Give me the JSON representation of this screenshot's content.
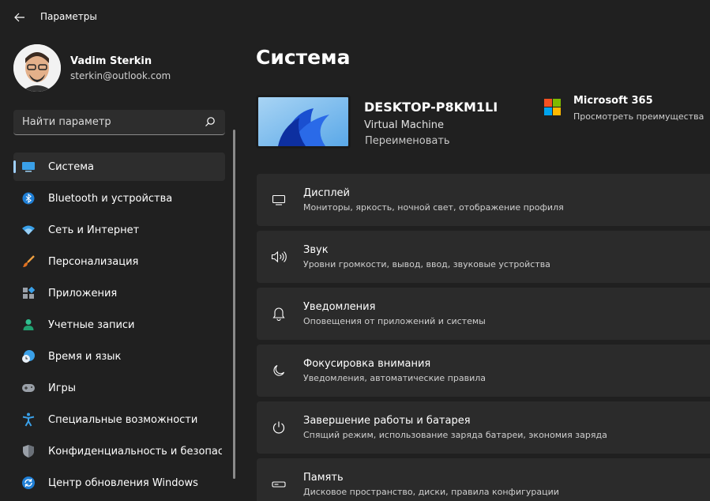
{
  "window": {
    "title": "Параметры"
  },
  "profile": {
    "name": "Vadim Sterkin",
    "email": "sterkin@outlook.com"
  },
  "search": {
    "placeholder": "Найти параметр"
  },
  "nav": {
    "items": [
      {
        "label": "Система",
        "icon": "monitor-icon",
        "active": true
      },
      {
        "label": "Bluetooth и устройства",
        "icon": "bluetooth-icon"
      },
      {
        "label": "Сеть и Интернет",
        "icon": "wifi-icon"
      },
      {
        "label": "Персонализация",
        "icon": "brush-icon"
      },
      {
        "label": "Приложения",
        "icon": "apps-icon"
      },
      {
        "label": "Учетные записи",
        "icon": "person-icon"
      },
      {
        "label": "Время и язык",
        "icon": "globe-clock-icon"
      },
      {
        "label": "Игры",
        "icon": "gamepad-icon"
      },
      {
        "label": "Специальные возможности",
        "icon": "accessibility-icon"
      },
      {
        "label": "Конфиденциальность и безопасность",
        "icon": "shield-icon"
      },
      {
        "label": "Центр обновления Windows",
        "icon": "update-icon"
      }
    ]
  },
  "main": {
    "title": "Система",
    "device": {
      "name": "DESKTOP-P8KM1LI",
      "type": "Virtual Machine",
      "rename": "Переименовать"
    },
    "promo": {
      "title": "Microsoft 365",
      "subtitle": "Просмотреть преимущества"
    },
    "cards": [
      {
        "title": "Дисплей",
        "subtitle": "Мониторы, яркость, ночной свет, отображение профиля",
        "icon": "display-icon"
      },
      {
        "title": "Звук",
        "subtitle": "Уровни громкости, вывод, ввод, звуковые устройства",
        "icon": "speaker-icon"
      },
      {
        "title": "Уведомления",
        "subtitle": "Оповещения от приложений и системы",
        "icon": "bell-icon"
      },
      {
        "title": "Фокусировка внимания",
        "subtitle": "Уведомления, автоматические правила",
        "icon": "moon-icon"
      },
      {
        "title": "Завершение работы и батарея",
        "subtitle": "Спящий режим, использование заряда батареи, экономия заряда",
        "icon": "power-icon"
      },
      {
        "title": "Память",
        "subtitle": "Дисковое пространство, диски, правила конфигурации",
        "icon": "storage-icon"
      }
    ]
  },
  "colors": {
    "accent": "#9fd0ff",
    "background": "#202020",
    "card": "#2b2b2b"
  }
}
